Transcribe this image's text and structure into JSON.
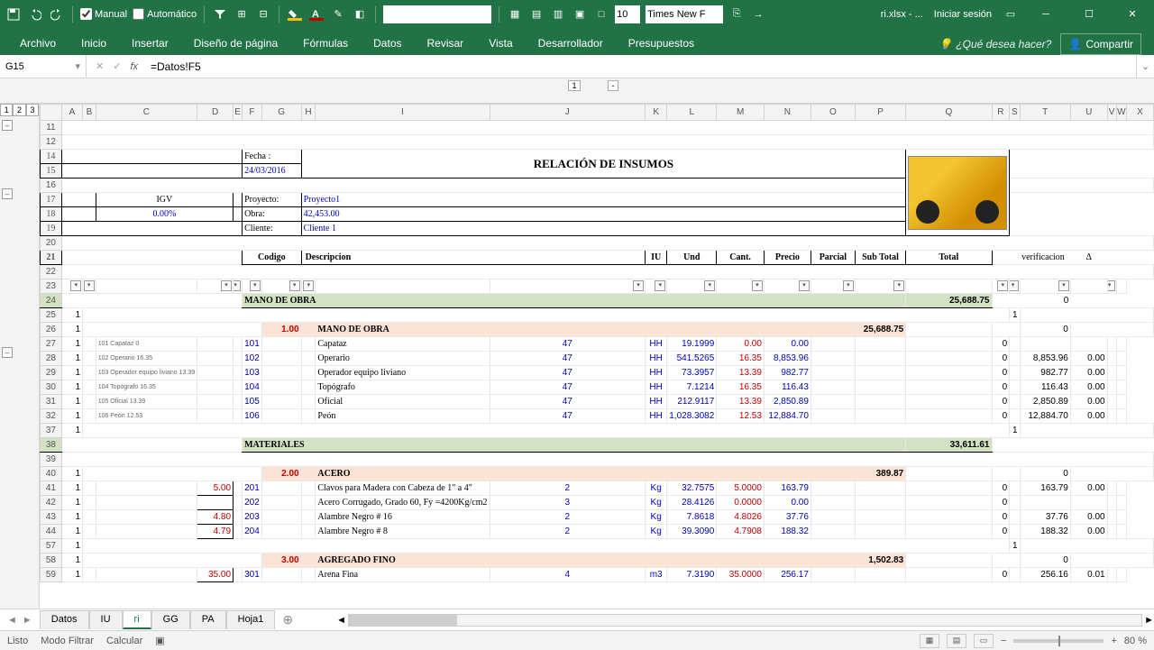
{
  "app": {
    "doc": "ri.xlsx - ...",
    "login": "Iniciar sesión"
  },
  "qat": {
    "manual": "Manual",
    "auto": "Automático",
    "font_size": "10",
    "font_name": "Times New F"
  },
  "tabs": [
    "Archivo",
    "Inicio",
    "Insertar",
    "Diseño de página",
    "Fórmulas",
    "Datos",
    "Revisar",
    "Vista",
    "Desarrollador",
    "Presupuestos"
  ],
  "tell_me": "¿Qué desea hacer?",
  "share": "Compartir",
  "namebox": "G15",
  "formula": "=Datos!F5",
  "col_levels": [
    "1",
    "-"
  ],
  "row_levels": [
    "1",
    "2",
    "3"
  ],
  "columns": [
    "A",
    "B",
    "C",
    "D",
    "E",
    "F",
    "G",
    "H",
    "I",
    "J",
    "K",
    "L",
    "M",
    "N",
    "O",
    "P",
    "Q",
    "R",
    "S",
    "T",
    "U",
    "V",
    "W",
    "X"
  ],
  "header": {
    "fecha_lbl": "Fecha :",
    "fecha": "24/03/2016",
    "title": "RELACIÓN DE INSUMOS",
    "igv_lbl": "IGV",
    "igv_val": "0.00%",
    "proyecto_lbl": "Proyecto:",
    "proyecto": "Proyecto1",
    "obra_lbl": "Obra:",
    "obra": "42,453.00",
    "cliente_lbl": "Cliente:",
    "cliente": "Cliente 1"
  },
  "thead": {
    "codigo": "Codigo",
    "desc": "Descripcion",
    "iu": "IU",
    "und": "Und",
    "cant": "Cant.",
    "precio": "Precio",
    "parcial": "Parcial",
    "subtotal": "Sub Total",
    "total": "Total",
    "verif": "verificacion",
    "delta": "Δ"
  },
  "sections": {
    "mano": {
      "label": "MANO DE OBRA",
      "total": "25,688.75",
      "code": "1.00",
      "sub": "25,688.75"
    },
    "mat": {
      "label": "MATERIALES",
      "total": "33,611.61"
    },
    "acero": {
      "code": "2.00",
      "label": "ACERO",
      "sub": "389.87"
    },
    "agfino": {
      "code": "3.00",
      "label": "AGREGADO FINO",
      "sub": "1,502.83"
    }
  },
  "rows_mano": [
    {
      "r": "27",
      "b": "1",
      "tiny": "101 Capataz 0",
      "cod": "101",
      "desc": "Capataz",
      "iu": "47",
      "und": "HH",
      "cant": "19.1999",
      "precio": "0.00",
      "parcial": "0.00",
      "s": "0",
      "t": "",
      "u": ""
    },
    {
      "r": "28",
      "b": "1",
      "tiny": "102 Operario 16.35",
      "cod": "102",
      "desc": "Operario",
      "iu": "47",
      "und": "HH",
      "cant": "541.5265",
      "precio": "16.35",
      "parcial": "8,853.96",
      "s": "0",
      "t": "8,853.96",
      "u": "0.00"
    },
    {
      "r": "29",
      "b": "1",
      "tiny": "103 Operador equipo liviano 13.39",
      "cod": "103",
      "desc": "Operador equipo liviano",
      "iu": "47",
      "und": "HH",
      "cant": "73.3957",
      "precio": "13.39",
      "parcial": "982.77",
      "s": "0",
      "t": "982.77",
      "u": "0.00"
    },
    {
      "r": "30",
      "b": "1",
      "tiny": "104 Topógrafo 16.35",
      "cod": "104",
      "desc": "Topógrafo",
      "iu": "47",
      "und": "HH",
      "cant": "7.1214",
      "precio": "16.35",
      "parcial": "116.43",
      "s": "0",
      "t": "116.43",
      "u": "0.00"
    },
    {
      "r": "31",
      "b": "1",
      "tiny": "105 Oficial 13.39",
      "cod": "105",
      "desc": "Oficial",
      "iu": "47",
      "und": "HH",
      "cant": "212.9117",
      "precio": "13.39",
      "parcial": "2,850.89",
      "s": "0",
      "t": "2,850.89",
      "u": "0.00"
    },
    {
      "r": "32",
      "b": "1",
      "tiny": "106 Peón 12.53",
      "cod": "106",
      "desc": "Peón",
      "iu": "47",
      "und": "HH",
      "cant": "1,028.3082",
      "precio": "12.53",
      "parcial": "12,884.70",
      "s": "0",
      "t": "12,884.70",
      "u": "0.00"
    }
  ],
  "rows_acero": [
    {
      "r": "41",
      "b": "1",
      "d": "5.00",
      "cod": "201",
      "desc": "Clavos para Madera con Cabeza de 1\" a 4\"",
      "iu": "2",
      "und": "Kg",
      "cant": "32.7575",
      "precio": "5.0000",
      "parcial": "163.79",
      "s": "0",
      "t": "163.79",
      "u": "0.00"
    },
    {
      "r": "42",
      "b": "1",
      "d": "",
      "cod": "202",
      "desc": "Acero Corrugado, Grado 60, Fy =4200Kg/cm2",
      "iu": "3",
      "und": "Kg",
      "cant": "28.4126",
      "precio": "0.0000",
      "parcial": "0.00",
      "s": "0",
      "t": "",
      "u": ""
    },
    {
      "r": "43",
      "b": "1",
      "d": "4.80",
      "cod": "203",
      "desc": "Alambre Negro # 16",
      "iu": "2",
      "und": "Kg",
      "cant": "7.8618",
      "precio": "4.8026",
      "parcial": "37.76",
      "s": "0",
      "t": "37.76",
      "u": "0.00"
    },
    {
      "r": "44",
      "b": "1",
      "d": "4.79",
      "cod": "204",
      "desc": "Alambre Negro #  8",
      "iu": "2",
      "und": "Kg",
      "cant": "39.3090",
      "precio": "4.7908",
      "parcial": "188.32",
      "s": "0",
      "t": "188.32",
      "u": "0.00"
    }
  ],
  "rows_agfino": [
    {
      "r": "59",
      "b": "1",
      "d": "35.00",
      "cod": "301",
      "desc": "Arena Fina",
      "iu": "4",
      "und": "m3",
      "cant": "7.3190",
      "precio": "35.0000",
      "parcial": "256.17",
      "s": "0",
      "t": "256.16",
      "u": "0.01"
    }
  ],
  "misc_rows": {
    "r11": "11",
    "r12": "12",
    "r14": "14",
    "r15": "15",
    "r16": "16",
    "r17": "17",
    "r18": "18",
    "r19": "19",
    "r20": "20",
    "r21": "21",
    "r22": "22",
    "r23": "23",
    "r24": "24",
    "r25": "25",
    "r26": "26",
    "r37": "37",
    "r38": "38",
    "r39": "39",
    "r40": "40",
    "r57": "57",
    "r58": "58"
  },
  "sheets": [
    "Datos",
    "IU",
    "ri",
    "GG",
    "PA",
    "Hoja1"
  ],
  "active_sheet": "ri",
  "status": {
    "ready": "Listo",
    "filter": "Modo Filtrar",
    "calc": "Calcular",
    "zoom": "80 %"
  }
}
